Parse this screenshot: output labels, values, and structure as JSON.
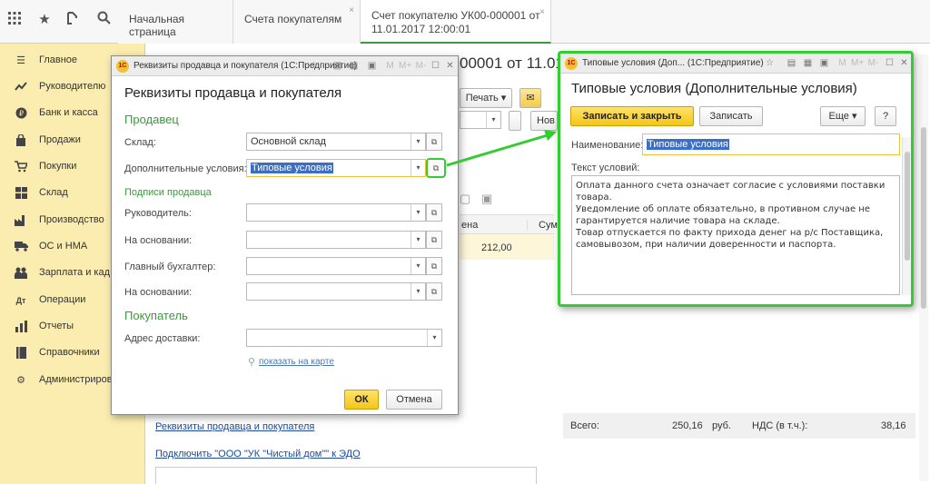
{
  "topbar": {
    "icons": [
      "apps-grid-icon",
      "star-icon",
      "history-icon",
      "search-icon"
    ],
    "tabs": [
      {
        "label": "Начальная страница"
      },
      {
        "label": "Счета покупателям"
      },
      {
        "label_line1": "Счет покупателю УК00-000001 от",
        "label_line2": "11.01.2017 12:00:01"
      }
    ],
    "close_glyph": "×"
  },
  "sidebar": {
    "items": [
      {
        "label": "Главное",
        "icon": "menu-icon"
      },
      {
        "label": "Руководителю",
        "icon": "trend-icon"
      },
      {
        "label": "Банк и касса",
        "icon": "coin-icon"
      },
      {
        "label": "Продажи",
        "icon": "bag-icon"
      },
      {
        "label": "Покупки",
        "icon": "cart-icon"
      },
      {
        "label": "Склад",
        "icon": "warehouse-icon"
      },
      {
        "label": "Производство",
        "icon": "factory-icon"
      },
      {
        "label": "ОС и НМА",
        "icon": "truck-icon"
      },
      {
        "label": "Зарплата и кад",
        "icon": "people-icon"
      },
      {
        "label": "Операции",
        "icon": "operations-icon"
      },
      {
        "label": "Отчеты",
        "icon": "chart-icon"
      },
      {
        "label": "Справочники",
        "icon": "book-icon"
      },
      {
        "label": "Администриров",
        "icon": "gear-icon"
      }
    ]
  },
  "document": {
    "title_fragment": "00001 от 11.01",
    "print_label": "Печать",
    "new_fragment": "Нов",
    "col_price_fragment": "ена",
    "col_sum_fragment": "Сум",
    "row_price": "212,00",
    "link_requisites": "Реквизиты продавца и покупателя",
    "link_edo": "Подключить \"ООО \"УК \"Чистый дом\"\" к ЭДО",
    "totals": {
      "total_label": "Всего:",
      "total_value": "250,16",
      "currency": "руб.",
      "vat_label": "НДС (в т.ч.):",
      "vat_value": "38,16"
    }
  },
  "dialog_requisites": {
    "window_title": "Реквизиты продавца и покупателя (1С:Предприятие)",
    "heading": "Реквизиты продавца и покупателя",
    "section_seller": "Продавец",
    "warehouse_label": "Склад:",
    "warehouse_value": "Основной склад",
    "extra_terms_label": "Дополнительные условия:",
    "extra_terms_value": "Типовые условия",
    "signatures_label": "Подписи продавца",
    "head_label": "Руководитель:",
    "basis_label": "На основании:",
    "accountant_label": "Главный бухгалтер:",
    "basis2_label": "На основании:",
    "section_buyer": "Покупатель",
    "delivery_label": "Адрес доставки:",
    "map_link": "показать на карте",
    "ok_label": "ОК",
    "cancel_label": "Отмена"
  },
  "dialog_terms": {
    "window_title": "Типовые условия (Доп... (1С:Предприятие)",
    "heading": "Типовые условия (Дополнительные условия)",
    "save_close_label": "Записать и закрыть",
    "save_label": "Записать",
    "more_label": "Еще",
    "help_label": "?",
    "name_label": "Наименование:",
    "name_value": "Типовые условия",
    "text_label": "Текст условий:",
    "text_lines": [
      "Оплата данного счета означает согласие с условиями поставки",
      "товара.",
      "Уведомление об оплате обязательно, в противном случае не",
      "гарантируется наличие товара на складе.",
      "Товар отпускается по факту прихода денег на р/с Поставщика,",
      "самовывозом, при наличии доверенности и паспорта."
    ]
  },
  "colors": {
    "sidebar_bg": "#fbedb0",
    "accent_green": "#3a9a3a",
    "highlight_green": "#33cc33",
    "primary_button": "#f5c518",
    "link": "#1a4a99",
    "selection": "#3a6fc8"
  }
}
